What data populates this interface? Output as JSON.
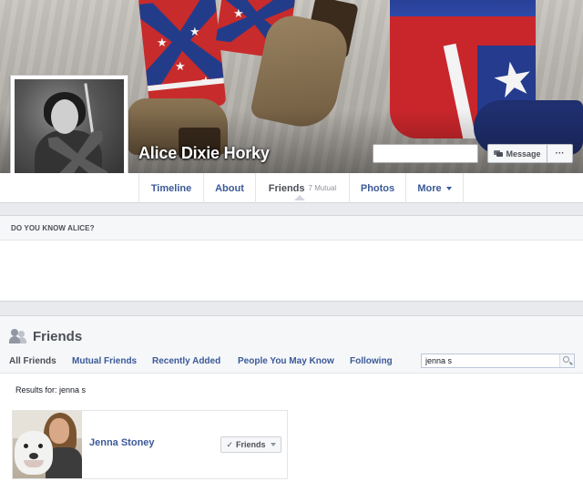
{
  "profile": {
    "name": "Alice Dixie Horky",
    "actions": {
      "message_label": "Message",
      "more_label": "···"
    }
  },
  "nav": {
    "tabs": [
      {
        "label": "Timeline"
      },
      {
        "label": "About"
      },
      {
        "label": "Friends",
        "sub": "7 Mutual"
      },
      {
        "label": "Photos"
      },
      {
        "label": "More"
      }
    ]
  },
  "know": {
    "header": "DO YOU KNOW ALICE?"
  },
  "friends": {
    "title": "Friends",
    "tabs": [
      "All Friends",
      "Mutual Friends",
      "Recently Added",
      "People You May Know",
      "Following"
    ],
    "search": {
      "value": "jenna s"
    },
    "results_label": "Results for: jenna s",
    "results": [
      {
        "name": "Jenna Stoney",
        "button_label": "Friends"
      }
    ]
  },
  "colors": {
    "link": "#3b5998",
    "page_bg": "#e9eaed"
  }
}
